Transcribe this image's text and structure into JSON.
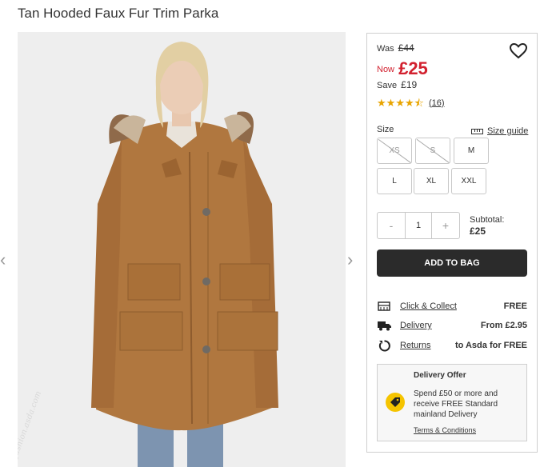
{
  "product": {
    "title": "Tan Hooded Faux Fur Trim Parka"
  },
  "gallery": {
    "prev_arrow": "‹",
    "next_arrow": "›",
    "watermark": "fashion.asda.com"
  },
  "price": {
    "was_label": "Was",
    "was_value": "£44",
    "now_label": "Now",
    "now_value": "£25",
    "save_label": "Save",
    "save_value": "£19",
    "now_color": "#d2212f"
  },
  "rating": {
    "stars": 4.5,
    "max": 5,
    "review_count": "(16)",
    "star_color": "#e8a400"
  },
  "size": {
    "label": "Size",
    "guide_label": "Size guide",
    "options": [
      {
        "label": "XS",
        "available": false
      },
      {
        "label": "S",
        "available": false
      },
      {
        "label": "M",
        "available": true
      },
      {
        "label": "L",
        "available": true
      },
      {
        "label": "XL",
        "available": true
      },
      {
        "label": "XXL",
        "available": true
      }
    ]
  },
  "quantity": {
    "minus": "-",
    "value": "1",
    "plus": "+"
  },
  "subtotal": {
    "label": "Subtotal:",
    "value": "£25"
  },
  "cta": {
    "add_to_bag": "ADD TO BAG",
    "bg_color": "#2b2b2b"
  },
  "delivery": {
    "options": [
      {
        "icon": "store-icon",
        "label": "Click & Collect",
        "value": "FREE"
      },
      {
        "icon": "truck-icon",
        "label": "Delivery",
        "value": "From £2.95"
      },
      {
        "icon": "return-icon",
        "label": "Returns",
        "value": "to Asda for FREE"
      }
    ]
  },
  "offer": {
    "title": "Delivery Offer",
    "text": "Spend £50 or more and receive FREE Standard mainland Delivery",
    "link": "Terms & Conditions",
    "icon": "tag-icon",
    "icon_color": "#f5c400"
  }
}
